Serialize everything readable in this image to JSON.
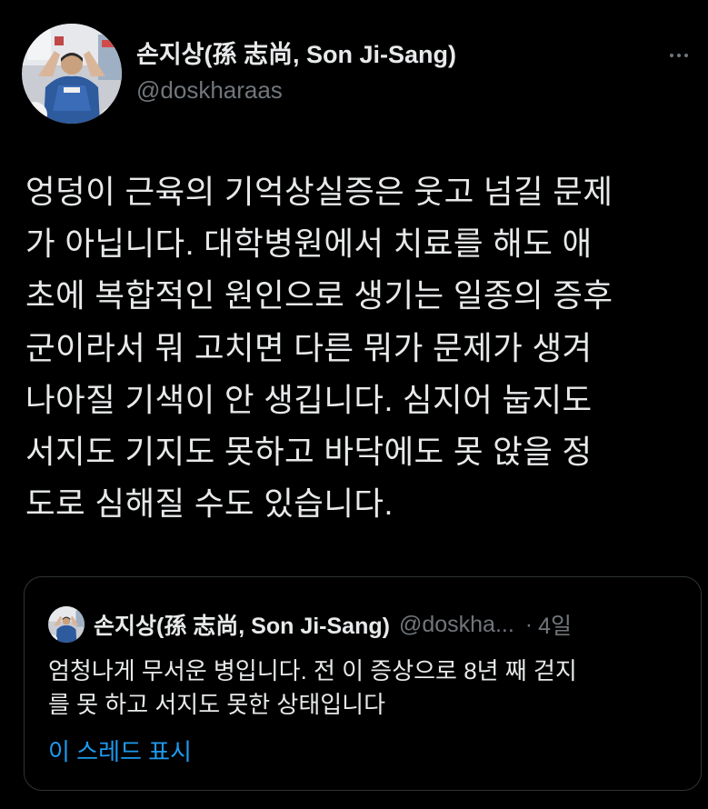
{
  "tweet": {
    "author": {
      "display_name": "손지상(孫 志尚, Son Ji-Sang)",
      "handle": "@doskharaas"
    },
    "more_icon": "more-horizontal-icon",
    "text_lines": [
      "엉덩이 근육의 기억상실증은 웃고 넘길 문제",
      "가 아닙니다. 대학병원에서 치료를 해도 애",
      "초에 복합적인 원인으로 생기는 일종의 증후",
      "군이라서 뭐 고치면 다른 뭐가 문제가 생겨",
      "나아질 기색이 안 생깁니다. 심지어 눕지도",
      "서지도 기지도 못하고 바닥에도 못 앉을 정",
      "도로 심해질 수도 있습니다."
    ]
  },
  "quote": {
    "display_name": "손지상(孫 志尚, Son Ji-Sang)",
    "handle": "@doskha...",
    "separator": "·",
    "time": "4일",
    "text_lines": [
      "엄청나게 무서운 병입니다. 전 이 증상으로 8년 째 걷지",
      "를 못 하고 서지도 못한 상태입니다"
    ],
    "show_thread": "이 스레드 표시"
  },
  "colors": {
    "background": "#000000",
    "text_primary": "#e7e9ea",
    "text_secondary": "#71767b",
    "link": "#1d9bf0",
    "border": "#2f3336"
  }
}
